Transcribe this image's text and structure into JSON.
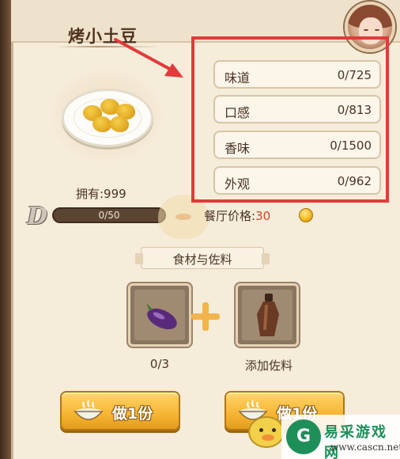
{
  "dish": {
    "title": "烤小土豆",
    "owned_label": "拥有:999",
    "progress_text": "0/50",
    "progress_fraction": 0,
    "rank_badge": "D"
  },
  "stats": [
    {
      "label": "味道",
      "value": "0/725"
    },
    {
      "label": "口感",
      "value": "0/813"
    },
    {
      "label": "香味",
      "value": "0/1500"
    },
    {
      "label": "外观",
      "value": "0/962"
    }
  ],
  "price": {
    "label": "餐厅价格:",
    "value": "30"
  },
  "ingredients": {
    "section_title": "食材与佐料",
    "ingredient_count": "0/3",
    "seasoning_label": "添加佐料"
  },
  "actions": {
    "make_one_label": "做1份",
    "make_one_label_2": "做1份"
  },
  "watermark": {
    "logo_mark": "G",
    "title": "易采游戏网",
    "url": "www.cascn.net"
  },
  "colors": {
    "highlight_frame": "#e33a3a",
    "button": "#f6b432",
    "price_value": "#d0482b"
  },
  "icons": [
    "potato-dish-icon",
    "eggplant-icon",
    "seasoning-bottle-icon",
    "bowl-icon",
    "coin-icon",
    "plus-icon",
    "avatar-portrait"
  ]
}
